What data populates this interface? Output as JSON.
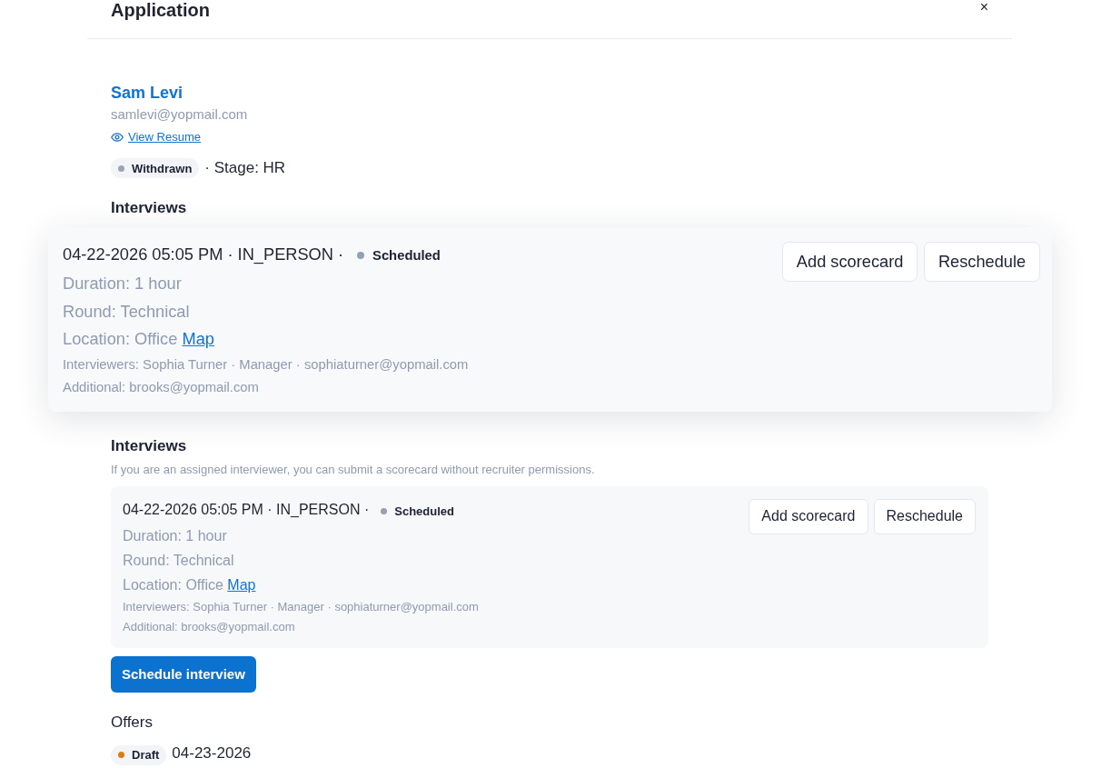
{
  "window": {
    "title": "Application",
    "close": "×"
  },
  "candidate": {
    "name": "Sam Levi",
    "email": "samlevi@yopmail.com",
    "resume_link": "View Resume",
    "status": {
      "label": "Withdrawn",
      "color": "#9ca3b4"
    },
    "stage": "· Stage: HR"
  },
  "interviews_preview": {
    "heading": "Interviews",
    "magnified_card": {
      "summary": "04-22-2026 05:05 PM · IN_PERSON ·",
      "status": {
        "label": "Scheduled",
        "color": "#94a0b4"
      },
      "actions": [
        "Add scorecard",
        "Reschedule"
      ],
      "details": [
        {
          "kind": "large",
          "text": "Duration: 1 hour"
        },
        {
          "kind": "large",
          "text": "Round: Technical"
        },
        {
          "kind": "large",
          "text": "Location: Office",
          "link": "Map"
        },
        {
          "kind": "small",
          "text": "Interviewers: Sophia Turner · Manager · sophiaturner@yopmail.com"
        },
        {
          "kind": "small",
          "text": "Additional: brooks@yopmail.com"
        }
      ]
    }
  },
  "interviews": {
    "heading": "Interviews",
    "hint": "If you are an assigned interviewer, you can submit a scorecard without recruiter permissions.",
    "items": [
      {
        "summary": "04-22-2026 05:05 PM · IN_PERSON ·",
        "status": {
          "label": "Scheduled",
          "color": "#94a0b4"
        },
        "actions": [
          "Add scorecard",
          "Reschedule"
        ],
        "details": [
          {
            "kind": "large",
            "text": "Duration: 1 hour"
          },
          {
            "kind": "large",
            "text": "Round: Technical"
          },
          {
            "kind": "large",
            "text": "Location: Office",
            "link": "Map"
          },
          {
            "kind": "small",
            "text": "Interviewers: Sophia Turner · Manager · sophiaturner@yopmail.com"
          },
          {
            "kind": "small",
            "text": "Additional: brooks@yopmail.com"
          }
        ]
      }
    ]
  },
  "schedule_button": "Schedule interview",
  "offers": {
    "heading": "Offers",
    "items": [
      {
        "status": {
          "label": "Draft",
          "color": "#e07b14"
        },
        "date": "04-23-2026"
      }
    ]
  }
}
